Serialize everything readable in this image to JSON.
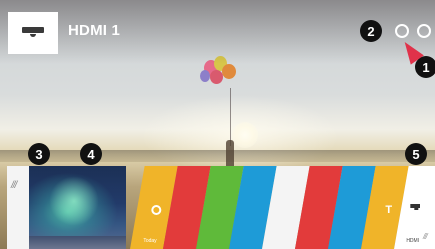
{
  "header": {
    "input_name": "HDMI 1",
    "input_icon": "tv-input-icon"
  },
  "callouts": {
    "c1": "1",
    "c2": "2",
    "c3": "3",
    "c4": "4",
    "c5": "5"
  },
  "top_icons": {
    "search": "search-icon",
    "settings": "settings-icon"
  },
  "launcher": {
    "recent_icon": "recent-icon",
    "tiles": [
      {
        "id": "tile-yellow",
        "color": "#f0b429",
        "label": "Today",
        "icon": "medal-icon"
      },
      {
        "id": "tile-red",
        "color": "#e23b3b"
      },
      {
        "id": "tile-green",
        "color": "#5fba3a"
      },
      {
        "id": "tile-blue",
        "color": "#1e9bd7"
      },
      {
        "id": "tile-white",
        "color": "#f4f4f4"
      },
      {
        "id": "tile-red2",
        "color": "#e23b3b"
      },
      {
        "id": "tile-blue2",
        "color": "#1e9bd7"
      },
      {
        "id": "tile-yellow2",
        "color": "#f0b429",
        "icon": "antenna-icon"
      },
      {
        "id": "tile-hdmi",
        "color": "#ffffff",
        "label": "HDMI 1",
        "icon": "hdmi-icon"
      }
    ],
    "more_icon": "more-icon"
  },
  "colors": {
    "pointer": "#e0324a",
    "callout_bg": "#111111"
  }
}
